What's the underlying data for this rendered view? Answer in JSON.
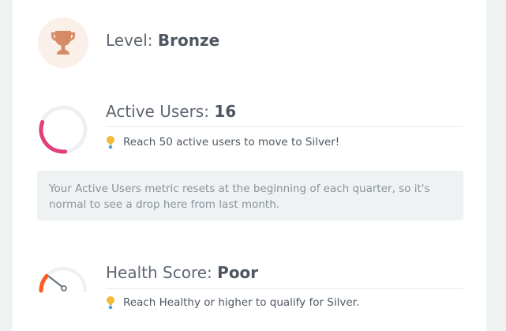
{
  "level": {
    "label": "Level:",
    "value": "Bronze",
    "icon": "trophy-icon",
    "badge_color": "#fbf0e9",
    "icon_color": "#d58b63"
  },
  "active_users": {
    "label": "Active Users:",
    "value": "16",
    "target": 50,
    "progress_fraction": 0.32,
    "ring_color": "#e23f7d",
    "track_color": "#eef1f3",
    "hint_icon": "lightbulb-icon",
    "hint": "Reach 50 active users to move to Silver!"
  },
  "note": {
    "text": "Your Active Users metric resets at the beginning of each quarter, so it's normal to see a drop here from last month."
  },
  "health_score": {
    "label": "Health Score:",
    "value": "Poor",
    "gauge_color": "#ff5a1f",
    "track_color": "#eef1f3",
    "needle_color": "#6b7682",
    "hint_icon": "lightbulb-icon",
    "hint": "Reach Healthy or higher to qualify for Silver."
  }
}
